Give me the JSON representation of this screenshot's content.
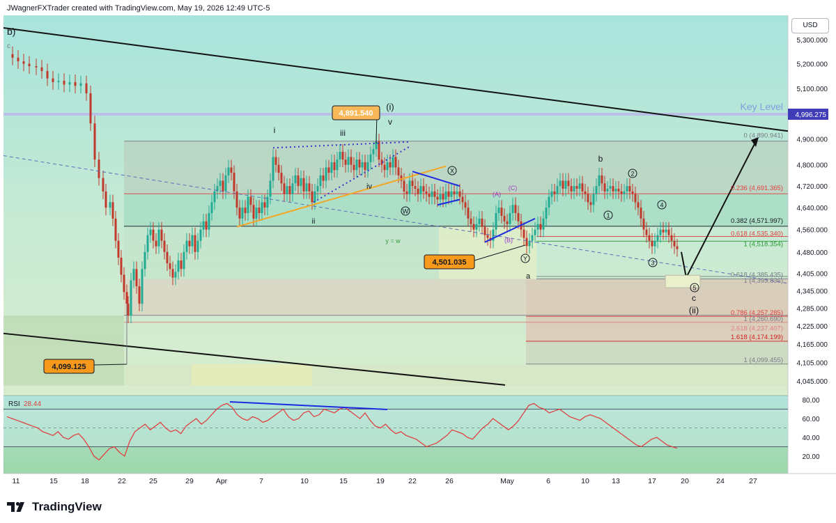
{
  "header": {
    "title": "JWagnerFXTrader created with TradingView.com, May 19, 2026 12:49 UTC-5"
  },
  "currency_button": "USD",
  "footer": {
    "brand": "TradingView"
  },
  "chart_data": [
    {
      "type": "line",
      "name": "price",
      "y_ticks": [
        "5,300.000",
        "5,200.000",
        "5,100.000",
        "5,000.000",
        "4,900.000",
        "4,800.000",
        "4,720.000",
        "4,640.000",
        "4,560.000",
        "4,480.000",
        "4,405.000",
        "4,345.000",
        "4,285.000",
        "4,225.000",
        "4,165.000",
        "4,105.000",
        "4,045.000"
      ],
      "x_ticks": [
        "11",
        "15",
        "18",
        "22",
        "25",
        "29",
        "Apr",
        "7",
        "10",
        "15",
        "19",
        "22",
        "26",
        "May",
        "6",
        "10",
        "13",
        "17",
        "20",
        "24",
        "27"
      ],
      "ylim": [
        4020,
        5330
      ],
      "log_scale": true,
      "current_price_label": "4,996.275",
      "key_level": {
        "label": "Key Level",
        "value": 4996.275
      },
      "price_callouts": [
        {
          "label": "4,891.540",
          "value": 4891.54
        },
        {
          "label": "4,501.035",
          "value": 4501.035
        },
        {
          "label": "4,099.125",
          "value": 4099.125
        }
      ],
      "fib_levels": [
        {
          "label": "0 (4,890.941)",
          "value": 4890.941,
          "color": "#787b86"
        },
        {
          "label": "0.236 (4,691.365)",
          "value": 4691.365,
          "color": "#e04040"
        },
        {
          "label": "0.382 (4,571.997)",
          "value": 4571.997,
          "color": "#131722"
        },
        {
          "label": "0.618 (4,535.340)",
          "value": 4535.34,
          "color": "#e04040"
        },
        {
          "label": "1 (4,518.354)",
          "value": 4518.354,
          "color": "#2e9a3a"
        },
        {
          "label": "0.618 (4,385.435)",
          "value": 4385.435,
          "color": "#787b86"
        },
        {
          "label": "1 (4,393.836)",
          "value": 4393.836,
          "color": "#787b86"
        },
        {
          "label": "0.786 (4,257.285)",
          "value": 4257.285,
          "color": "#e04040"
        },
        {
          "label": "1 (4,260.690)",
          "value": 4260.69,
          "color": "#787b86"
        },
        {
          "label": "2.618 (4,237.407)",
          "value": 4237.407,
          "color": "#e08080"
        },
        {
          "label": "1.618 (4,174.199)",
          "value": 4174.199,
          "color": "#d02020"
        },
        {
          "label": "1 (4,099.455)",
          "value": 4099.455,
          "color": "#787b86"
        }
      ],
      "wave_labels": [
        "b)",
        "c",
        "i",
        "iii",
        "(i)",
        "v",
        "iv",
        "ii",
        "(ii)",
        "b",
        "a",
        "c",
        "y = w"
      ],
      "circled_wave_labels": [
        "X",
        "W",
        "Y",
        "1",
        "2",
        "3",
        "4",
        "5"
      ],
      "purple_wave_labels": [
        "(A)",
        "(C)",
        "(B)"
      ],
      "key_points": [
        {
          "x": "Mar 10",
          "y": 5240
        },
        {
          "x": "Mar 22",
          "y": 4099.125
        },
        {
          "x": "Apr 18",
          "y": 4891.54
        },
        {
          "x": "May 4",
          "y": 4501.035
        },
        {
          "x": "May 11",
          "y": 4760
        },
        {
          "x": "May 18",
          "y": 4490
        }
      ],
      "projection": {
        "from": 4390,
        "to": 4890
      }
    },
    {
      "type": "line",
      "name": "RSI",
      "label": "RSI",
      "value_label": "28.44",
      "value": 28.44,
      "y_ticks": [
        "80.00",
        "60.00",
        "40.00",
        "20.00"
      ],
      "ylim": [
        10,
        85
      ],
      "bands": [
        70,
        30
      ]
    }
  ],
  "colors": {
    "up": "#22ab94",
    "down": "#c0392b",
    "bg_bull": "#cdeee0",
    "rsi": "#e04040",
    "fib_red": "#e04040"
  }
}
